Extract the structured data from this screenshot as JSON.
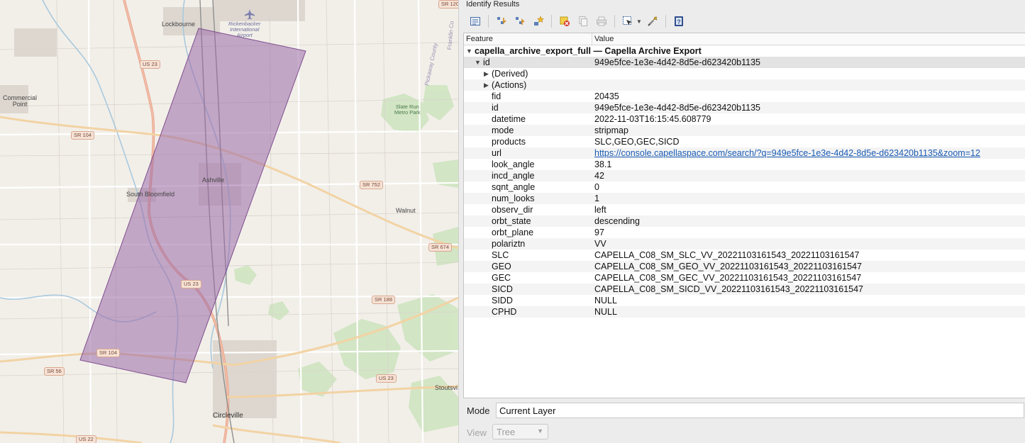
{
  "map": {
    "footprint_color": "#9b6aa8",
    "labels": {
      "lockbourne": "Lockbourne",
      "airport": "Rickenbacker\nInternational\nAirport",
      "commercial_point": "Commercial\nPoint",
      "south_bloomfield": "South Bloomfield",
      "ashville": "Ashville",
      "walnut": "Walnut",
      "circleville": "Circleville",
      "stoutsville": "Stoutsvi",
      "slate_run": "Slate Run\nMetro Park",
      "pickaway_county": "Pickaway County",
      "franklin_county": "Franklin Co",
      "us23_a": "US 23",
      "us23_b": "US 23",
      "us23_c": "US 23",
      "us22": "US 22",
      "sr104_a": "SR 104",
      "sr104_b": "SR 104",
      "sr56": "SR 56",
      "sr752": "SR 752",
      "sr674": "SR 674",
      "sr188": "SR 188",
      "sr120": "SR 120"
    }
  },
  "panel": {
    "title": "Identify Results",
    "toolbar_icons": [
      "expand-tree-icon",
      "expand-all-icon",
      "collapse-all-icon",
      "highlight-icon",
      "clear-results-icon",
      "copy-icon",
      "print-icon",
      "select-features-icon",
      "settings-icon",
      "help-icon"
    ],
    "columns": {
      "feature": "Feature",
      "value": "Value"
    },
    "layer": {
      "name": "capella_archive_export_full — Capella Archive Export"
    },
    "feature": {
      "name": "id",
      "value": "949e5fce-1e3e-4d42-8d5e-d623420b1135"
    },
    "derived": "(Derived)",
    "actions": "(Actions)",
    "attributes": [
      {
        "name": "fid",
        "value": "20435"
      },
      {
        "name": "id",
        "value": "949e5fce-1e3e-4d42-8d5e-d623420b1135"
      },
      {
        "name": "datetime",
        "value": "2022-11-03T16:15:45.608779"
      },
      {
        "name": "mode",
        "value": "stripmap"
      },
      {
        "name": "products",
        "value": "SLC,GEO,GEC,SICD"
      },
      {
        "name": "url",
        "value": "https://console.capellaspace.com/search/?q=949e5fce-1e3e-4d42-8d5e-d623420b1135&zoom=12"
      },
      {
        "name": "look_angle",
        "value": "38.1"
      },
      {
        "name": "incd_angle",
        "value": "42"
      },
      {
        "name": "sqnt_angle",
        "value": "0"
      },
      {
        "name": "num_looks",
        "value": "1"
      },
      {
        "name": "observ_dir",
        "value": "left"
      },
      {
        "name": "orbt_state",
        "value": "descending"
      },
      {
        "name": "orbt_plane",
        "value": "97"
      },
      {
        "name": "polariztn",
        "value": "VV"
      },
      {
        "name": "SLC",
        "value": "CAPELLA_C08_SM_SLC_VV_20221103161543_20221103161547"
      },
      {
        "name": "GEO",
        "value": "CAPELLA_C08_SM_GEO_VV_20221103161543_20221103161547"
      },
      {
        "name": "GEC",
        "value": "CAPELLA_C08_SM_GEC_VV_20221103161543_20221103161547"
      },
      {
        "name": "SICD",
        "value": "CAPELLA_C08_SM_SICD_VV_20221103161543_20221103161547"
      },
      {
        "name": "SIDD",
        "value": "NULL"
      },
      {
        "name": "CPHD",
        "value": "NULL"
      }
    ],
    "mode": {
      "label": "Mode",
      "value": "Current Layer"
    },
    "view": {
      "label": "View",
      "value": "Tree"
    }
  }
}
